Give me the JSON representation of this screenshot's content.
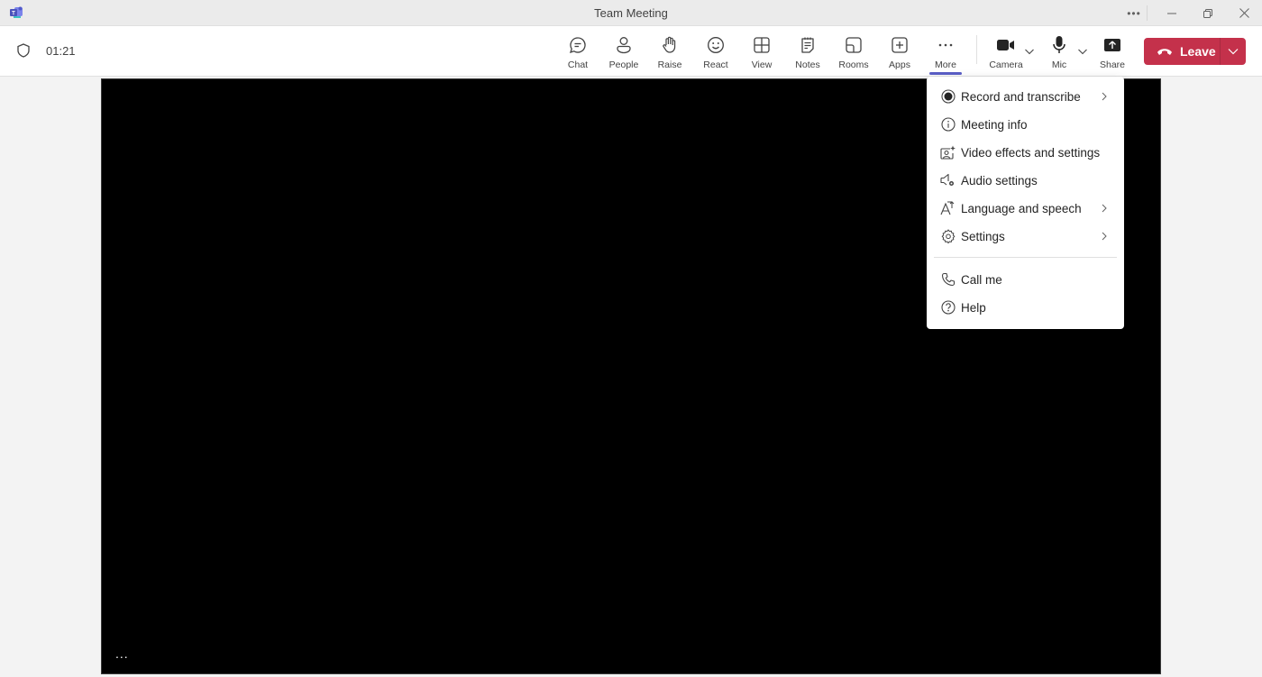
{
  "window": {
    "title": "Team Meeting",
    "controls": {
      "more": "more-options",
      "minimize": "minimize",
      "restore": "restore",
      "close": "close"
    }
  },
  "meeting": {
    "elapsed_time": "01:21"
  },
  "toolbar": {
    "buttons": [
      {
        "id": "chat",
        "label": "Chat",
        "icon": "chat-icon"
      },
      {
        "id": "people",
        "label": "People",
        "icon": "people-icon"
      },
      {
        "id": "raise",
        "label": "Raise",
        "icon": "hand-icon"
      },
      {
        "id": "react",
        "label": "React",
        "icon": "smiley-icon"
      },
      {
        "id": "view",
        "label": "View",
        "icon": "grid-icon"
      },
      {
        "id": "notes",
        "label": "Notes",
        "icon": "notes-icon"
      },
      {
        "id": "rooms",
        "label": "Rooms",
        "icon": "rooms-icon"
      },
      {
        "id": "apps",
        "label": "Apps",
        "icon": "plus-box-icon"
      },
      {
        "id": "more",
        "label": "More",
        "icon": "ellipsis-icon",
        "active": true
      }
    ],
    "devices": [
      {
        "id": "camera",
        "label": "Camera",
        "icon": "camera-icon"
      },
      {
        "id": "mic",
        "label": "Mic",
        "icon": "mic-icon"
      },
      {
        "id": "share",
        "label": "Share",
        "icon": "share-icon"
      }
    ],
    "leave": {
      "label": "Leave",
      "color": "#c4314b"
    },
    "active_indicator_color": "#5b5fc7"
  },
  "more_menu": {
    "items": [
      {
        "label": "Record and transcribe",
        "icon": "record-icon",
        "submenu": true
      },
      {
        "label": "Meeting info",
        "icon": "info-icon",
        "submenu": false
      },
      {
        "label": "Video effects and settings",
        "icon": "video-effects-icon",
        "submenu": false
      },
      {
        "label": "Audio settings",
        "icon": "audio-settings-icon",
        "submenu": false
      },
      {
        "label": "Language and speech",
        "icon": "language-icon",
        "submenu": true
      },
      {
        "label": "Settings",
        "icon": "gear-icon",
        "submenu": true
      }
    ],
    "secondary_items": [
      {
        "label": "Call me",
        "icon": "phone-icon"
      },
      {
        "label": "Help",
        "icon": "help-icon"
      }
    ]
  },
  "stage": {
    "options_label": "..."
  }
}
